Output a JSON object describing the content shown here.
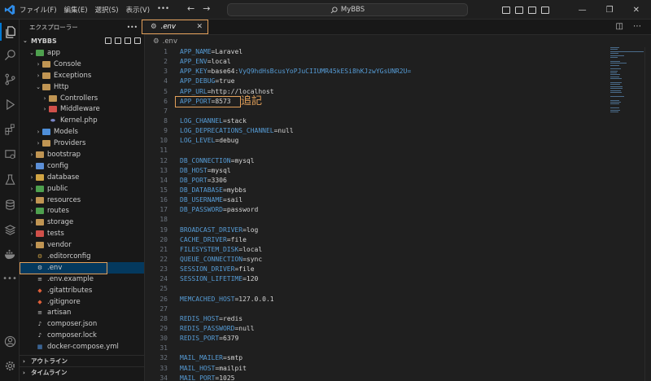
{
  "titlebar": {
    "menu": [
      "ファイル(F)",
      "編集(E)",
      "選択(S)",
      "表示(V)",
      "•••"
    ],
    "search_text": "MyBBS"
  },
  "sidebar": {
    "title": "エクスプローラー",
    "more": "•••",
    "project": "MYBBS",
    "tree": [
      {
        "label": "app",
        "depth": 1,
        "type": "folder",
        "open": true,
        "color": "#4ea04e"
      },
      {
        "label": "Console",
        "depth": 2,
        "type": "folder",
        "open": false,
        "color": "#c09553"
      },
      {
        "label": "Exceptions",
        "depth": 2,
        "type": "folder",
        "open": false,
        "color": "#c09553"
      },
      {
        "label": "Http",
        "depth": 2,
        "type": "folder",
        "open": true,
        "color": "#c09553"
      },
      {
        "label": "Controllers",
        "depth": 3,
        "type": "folder",
        "open": false,
        "color": "#c09553"
      },
      {
        "label": "Middleware",
        "depth": 3,
        "type": "folder",
        "open": false,
        "color": "#d0504a"
      },
      {
        "label": "Kernel.php",
        "depth": 3,
        "type": "file",
        "icon": "php",
        "color": "#7a86c8"
      },
      {
        "label": "Models",
        "depth": 2,
        "type": "folder",
        "open": false,
        "color": "#4e8ed8"
      },
      {
        "label": "Providers",
        "depth": 2,
        "type": "folder",
        "open": false,
        "color": "#c09553"
      },
      {
        "label": "bootstrap",
        "depth": 1,
        "type": "folder",
        "open": false,
        "color": "#c09553"
      },
      {
        "label": "config",
        "depth": 1,
        "type": "folder",
        "open": false,
        "color": "#5c8fd6"
      },
      {
        "label": "database",
        "depth": 1,
        "type": "folder",
        "open": false,
        "color": "#d0a444"
      },
      {
        "label": "public",
        "depth": 1,
        "type": "folder",
        "open": false,
        "color": "#4ea04e"
      },
      {
        "label": "resources",
        "depth": 1,
        "type": "folder",
        "open": false,
        "color": "#c09553"
      },
      {
        "label": "routes",
        "depth": 1,
        "type": "folder",
        "open": false,
        "color": "#4ea04e"
      },
      {
        "label": "storage",
        "depth": 1,
        "type": "folder",
        "open": false,
        "color": "#c09553"
      },
      {
        "label": "tests",
        "depth": 1,
        "type": "folder",
        "open": false,
        "color": "#d0504a"
      },
      {
        "label": "vendor",
        "depth": 1,
        "type": "folder",
        "open": false,
        "color": "#c09553"
      },
      {
        "label": ".editorconfig",
        "depth": 1,
        "type": "file",
        "icon": "gear",
        "color": "#d0a444"
      },
      {
        "label": ".env",
        "depth": 1,
        "type": "file",
        "icon": "gear",
        "color": "#cccccc",
        "selected": true
      },
      {
        "label": ".env.example",
        "depth": 1,
        "type": "file",
        "icon": "lines",
        "color": "#cccccc"
      },
      {
        "label": ".gitattributes",
        "depth": 1,
        "type": "file",
        "icon": "git",
        "color": "#e0603a"
      },
      {
        "label": ".gitignore",
        "depth": 1,
        "type": "file",
        "icon": "git",
        "color": "#e0603a"
      },
      {
        "label": "artisan",
        "depth": 1,
        "type": "file",
        "icon": "lines",
        "color": "#cccccc"
      },
      {
        "label": "composer.json",
        "depth": 1,
        "type": "file",
        "icon": "composer",
        "color": "#cccccc"
      },
      {
        "label": "composer.lock",
        "depth": 1,
        "type": "file",
        "icon": "composer",
        "color": "#cccccc"
      },
      {
        "label": "docker-compose.yml",
        "depth": 1,
        "type": "file",
        "icon": "docker",
        "color": "#4e8ed8"
      }
    ],
    "outline": "アウトライン",
    "timeline": "タイムライン"
  },
  "editor": {
    "tab_label": ".env",
    "tab_close": "✕",
    "breadcrumb": ".env",
    "annotation": "追記",
    "lines": [
      {
        "n": "1",
        "k": "APP_NAME",
        "v": "Laravel"
      },
      {
        "n": "2",
        "k": "APP_ENV",
        "v": "local"
      },
      {
        "n": "3",
        "k": "APP_KEY",
        "v": "base64:",
        "v2": "VyQ9hdHsBcusYoPJuCIIUMR45kESi8hKJzwYGsUNR2U="
      },
      {
        "n": "4",
        "k": "APP_DEBUG",
        "v": "true"
      },
      {
        "n": "5",
        "k": "APP_URL",
        "v": "http://localhost"
      },
      {
        "n": "6",
        "k": "APP_PORT",
        "v": "8573"
      },
      {
        "n": "7",
        "k": "",
        "v": ""
      },
      {
        "n": "8",
        "k": "LOG_CHANNEL",
        "v": "stack"
      },
      {
        "n": "9",
        "k": "LOG_DEPRECATIONS_CHANNEL",
        "v": "null"
      },
      {
        "n": "10",
        "k": "LOG_LEVEL",
        "v": "debug"
      },
      {
        "n": "11",
        "k": "",
        "v": ""
      },
      {
        "n": "12",
        "k": "DB_CONNECTION",
        "v": "mysql"
      },
      {
        "n": "13",
        "k": "DB_HOST",
        "v": "mysql"
      },
      {
        "n": "14",
        "k": "DB_PORT",
        "v": "3306"
      },
      {
        "n": "15",
        "k": "DB_DATABASE",
        "v": "mybbs"
      },
      {
        "n": "16",
        "k": "DB_USERNAME",
        "v": "sail"
      },
      {
        "n": "17",
        "k": "DB_PASSWORD",
        "v": "password"
      },
      {
        "n": "18",
        "k": "",
        "v": ""
      },
      {
        "n": "19",
        "k": "BROADCAST_DRIVER",
        "v": "log"
      },
      {
        "n": "20",
        "k": "CACHE_DRIVER",
        "v": "file"
      },
      {
        "n": "21",
        "k": "FILESYSTEM_DISK",
        "v": "local"
      },
      {
        "n": "22",
        "k": "QUEUE_CONNECTION",
        "v": "sync"
      },
      {
        "n": "23",
        "k": "SESSION_DRIVER",
        "v": "file"
      },
      {
        "n": "24",
        "k": "SESSION_LIFETIME",
        "v": "120"
      },
      {
        "n": "25",
        "k": "",
        "v": ""
      },
      {
        "n": "26",
        "k": "MEMCACHED_HOST",
        "v": "127.0.0.1"
      },
      {
        "n": "27",
        "k": "",
        "v": ""
      },
      {
        "n": "28",
        "k": "REDIS_HOST",
        "v": "redis"
      },
      {
        "n": "29",
        "k": "REDIS_PASSWORD",
        "v": "null"
      },
      {
        "n": "30",
        "k": "REDIS_PORT",
        "v": "6379"
      },
      {
        "n": "31",
        "k": "",
        "v": ""
      },
      {
        "n": "32",
        "k": "MAIL_MAILER",
        "v": "smtp"
      },
      {
        "n": "33",
        "k": "MAIL_HOST",
        "v": "mailpit"
      },
      {
        "n": "34",
        "k": "MAIL_PORT",
        "v": "1025"
      }
    ]
  },
  "colors": {
    "accent": "#0078d4",
    "highlight_box": "#e3a05a",
    "key": "#569cd6",
    "selected_row": "#04395e"
  }
}
